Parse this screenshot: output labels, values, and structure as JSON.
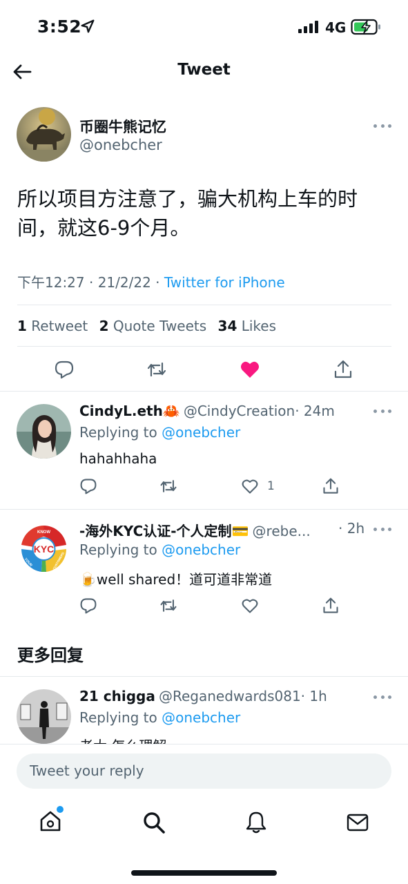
{
  "status_bar": {
    "time": "3:52",
    "network": "4G"
  },
  "header": {
    "title": "Tweet"
  },
  "tweet": {
    "author_name": "币圈牛熊记忆",
    "author_handle": "@onebcher",
    "text": "所以项目方注意了，骗大机构上车的时间，就这6-9个月。",
    "timestamp": "下午12:27 · 21/2/22 · ",
    "source": "Twitter for iPhone",
    "stats": {
      "retweets_count": "1",
      "retweets_label": "Retweet",
      "quotes_count": "2",
      "quotes_label": "Quote Tweets",
      "likes_count": "34",
      "likes_label": "Likes"
    }
  },
  "replies": [
    {
      "name": "CindyL.eth🦀",
      "handle": "@CindyCreation",
      "time": "· 24m",
      "replying_prefix": "Replying to ",
      "replying_to": "@onebcher",
      "text": "hahahhaha",
      "like_count": "1"
    },
    {
      "name": "-海外KYC认证-个人定制💳",
      "handle": "@rebe...",
      "time": "· 2h",
      "replying_prefix": "Replying to ",
      "replying_to": "@onebcher",
      "text": "🍺well shared！道可道非常道",
      "like_count": ""
    }
  ],
  "more_replies_heading": "更多回复",
  "more_replies": [
    {
      "name": "21 chigga",
      "handle": "@Reganedwards081",
      "time": "· 1h",
      "replying_prefix": "Replying to ",
      "replying_to": "@onebcher",
      "text": "老大 怎么理解"
    }
  ],
  "reply_box": {
    "placeholder": "Tweet your reply"
  },
  "kyc_logo": {
    "top": "KNOW",
    "center": "KYC",
    "left": "YOUR",
    "right": "CUSTOMERS"
  },
  "colors": {
    "accent": "#1d9bf0",
    "like": "#f91880",
    "muted": "#536471"
  },
  "icons": [
    "back-arrow-icon",
    "location-arrow-icon",
    "signal-icon",
    "battery-charging-icon",
    "more-icon",
    "reply-icon",
    "retweet-icon",
    "like-icon",
    "share-icon",
    "home-icon",
    "search-icon",
    "notifications-icon",
    "messages-icon"
  ]
}
